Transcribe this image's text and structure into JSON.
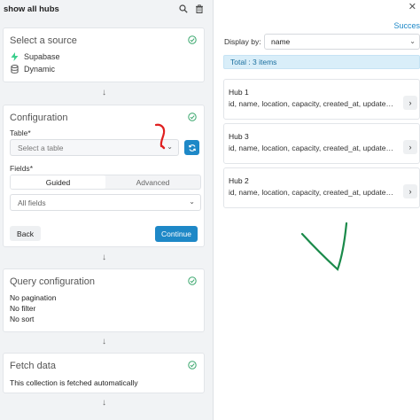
{
  "header": {
    "title": "show all hubs",
    "icons": [
      "search-icon",
      "trash-icon"
    ]
  },
  "source_card": {
    "title": "Select a source",
    "items": [
      {
        "label": "Supabase",
        "icon": "supabase-bolt-icon",
        "color": "#3ecf8e"
      },
      {
        "label": "Dynamic",
        "icon": "database-icon"
      }
    ]
  },
  "config_card": {
    "title": "Configuration",
    "table_label": "Table",
    "table_placeholder": "Select a table",
    "fields_label": "Fields",
    "required_mark": "*",
    "tabs": [
      {
        "label": "Guided",
        "active": true
      },
      {
        "label": "Advanced",
        "active": false
      }
    ],
    "fields_value": "All fields",
    "back_label": "Back",
    "continue_label": "Continue"
  },
  "query_card": {
    "title": "Query configuration",
    "lines": [
      "No pagination",
      "No filter",
      "No sort"
    ]
  },
  "fetch_card": {
    "title": "Fetch data",
    "text": "This collection is fetched automatically"
  },
  "right": {
    "success": "Succes",
    "display_by_label": "Display by:",
    "display_by_value": "name",
    "total": "Total : 3 items",
    "hubs": [
      {
        "name": "Hub 1",
        "fields": "id, name, location, capacity, created_at, updated_at"
      },
      {
        "name": "Hub 3",
        "fields": "id, name, location, capacity, created_at, updated_at"
      },
      {
        "name": "Hub 2",
        "fields": "id, name, location, capacity, created_at, updated_at"
      }
    ]
  },
  "colors": {
    "accent": "#1e88c7",
    "success_check": "#3aa76d",
    "annotation_red": "#e02020",
    "annotation_green": "#1a8a4a"
  }
}
